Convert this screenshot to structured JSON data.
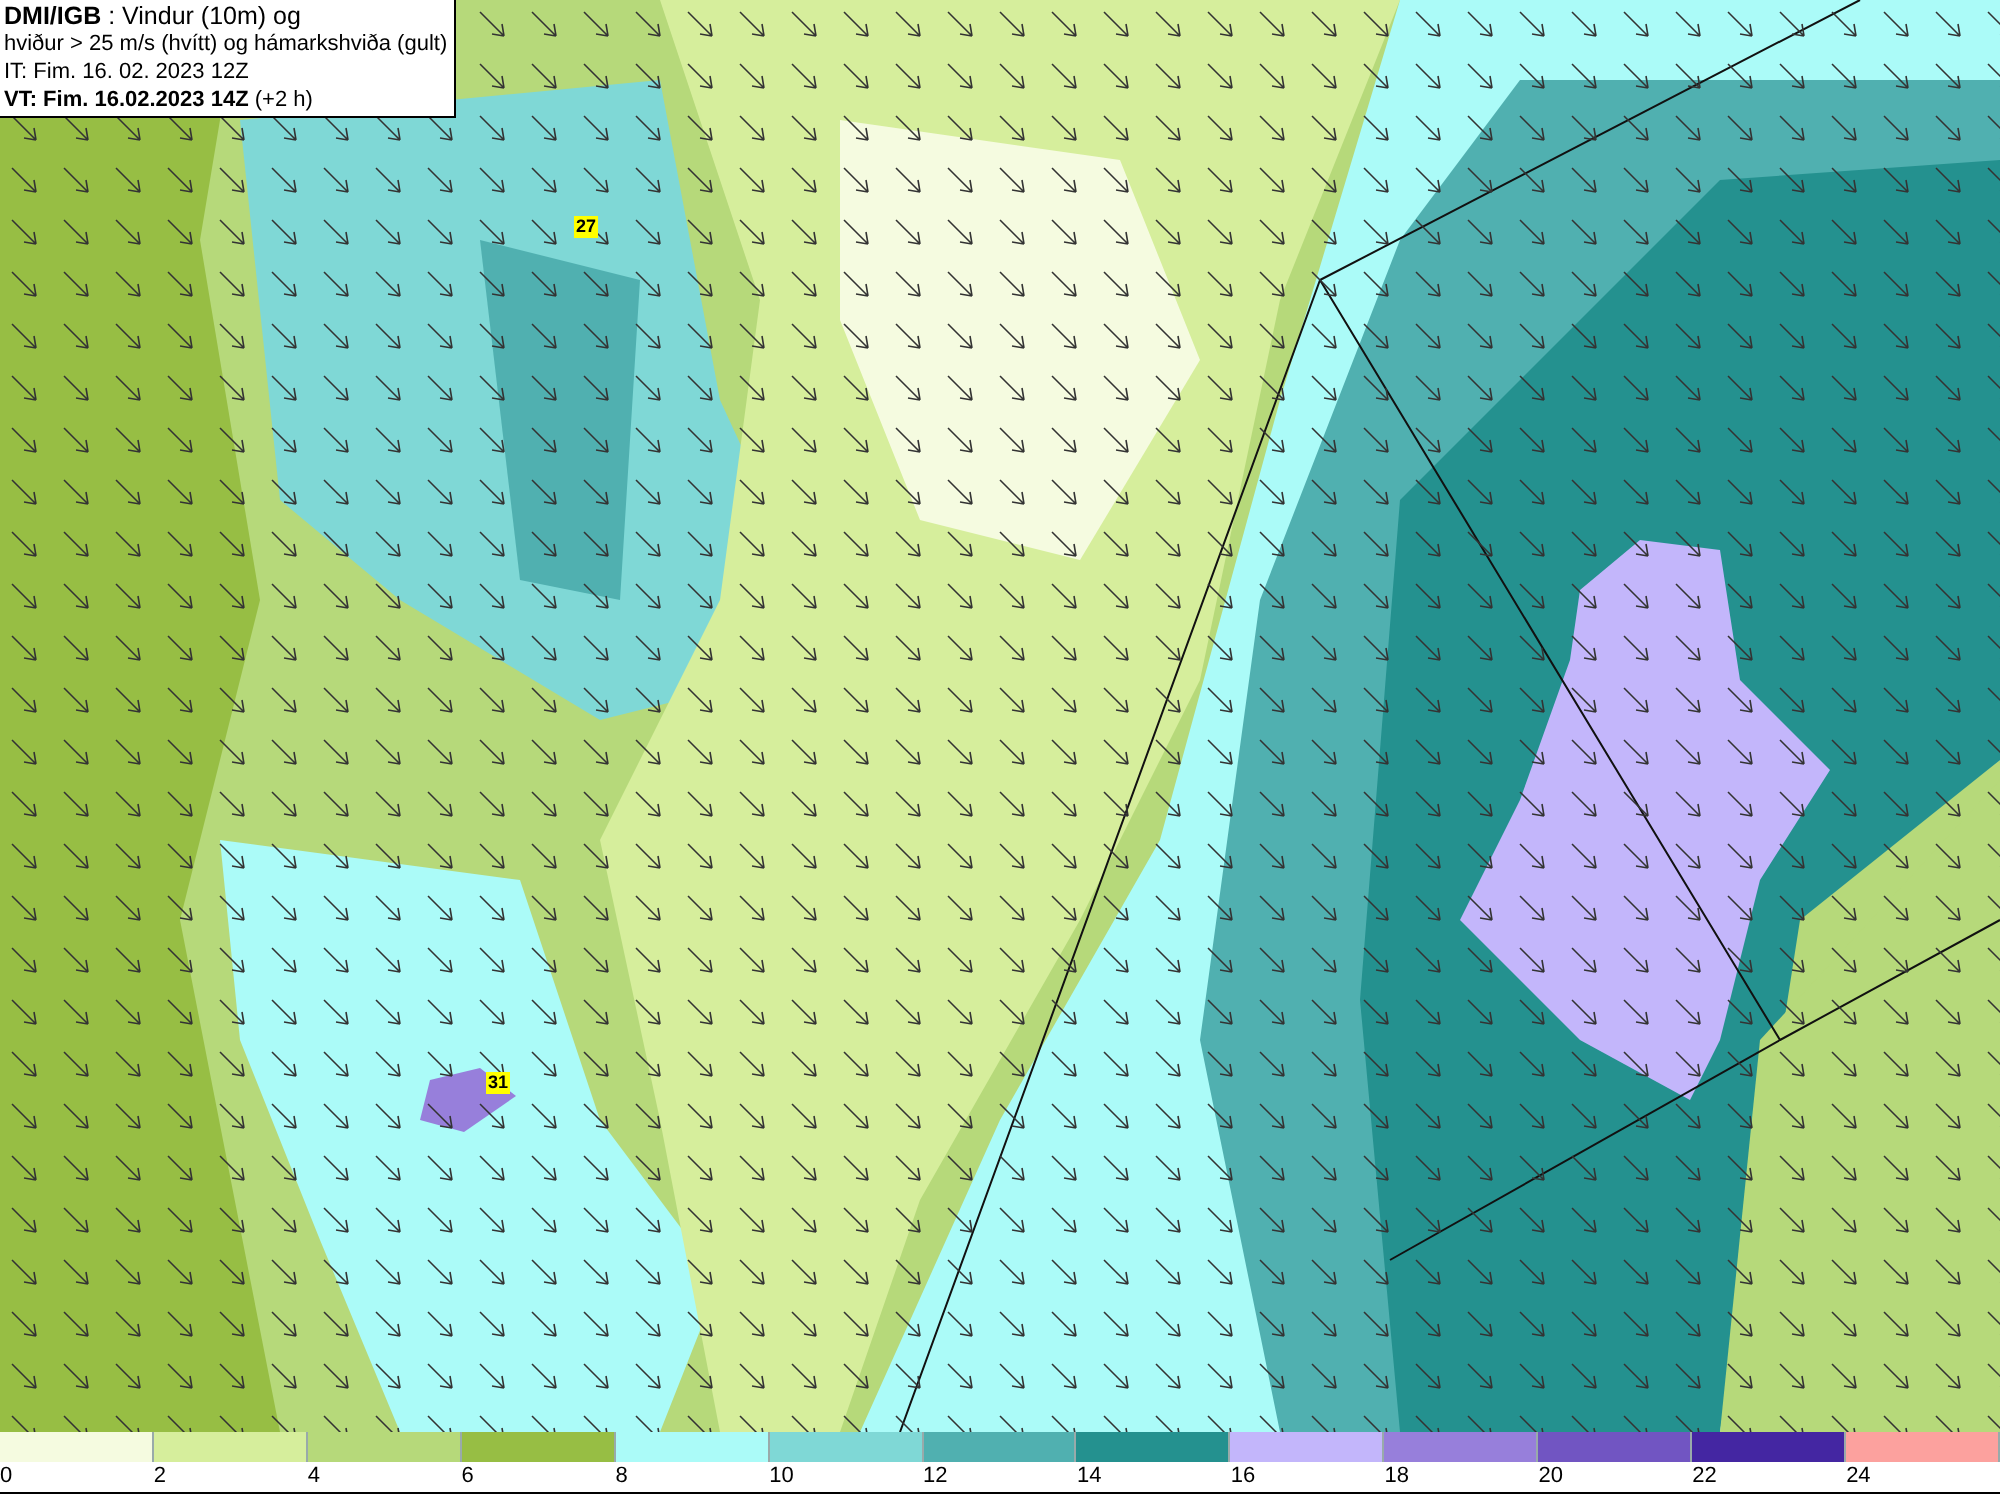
{
  "header": {
    "lines": [
      "**DMI/IGB** : Vindur (10m) og",
      "hviður > 25 m/s (hvítt) og hámarkshviða (gult)",
      "IT: Fim. 16. 02. 2023 12Z",
      "**VT: Fim. 16.02.2023 14Z** (+2 h)"
    ]
  },
  "map": {
    "gust_labels": [
      {
        "text": "27"
      },
      {
        "text": "31"
      }
    ]
  },
  "legend": {
    "bins": [
      {
        "color": "#f5fbe0"
      },
      {
        "color": "#d6ee9c"
      },
      {
        "color": "#b6d97a"
      },
      {
        "color": "#97be44"
      },
      {
        "color": "#abfbf8"
      },
      {
        "color": "#7fd8d6"
      },
      {
        "color": "#50b0b0"
      },
      {
        "color": "#24918f"
      },
      {
        "color": "#c3b6fb"
      },
      {
        "color": "#977fdb"
      },
      {
        "color": "#7155c2"
      },
      {
        "color": "#4426a2"
      },
      {
        "color": "#fca19e"
      }
    ],
    "ticks": [
      "0",
      "2",
      "4",
      "6",
      "8",
      "10",
      "12",
      "14",
      "16",
      "18",
      "20",
      "22",
      "24"
    ]
  }
}
